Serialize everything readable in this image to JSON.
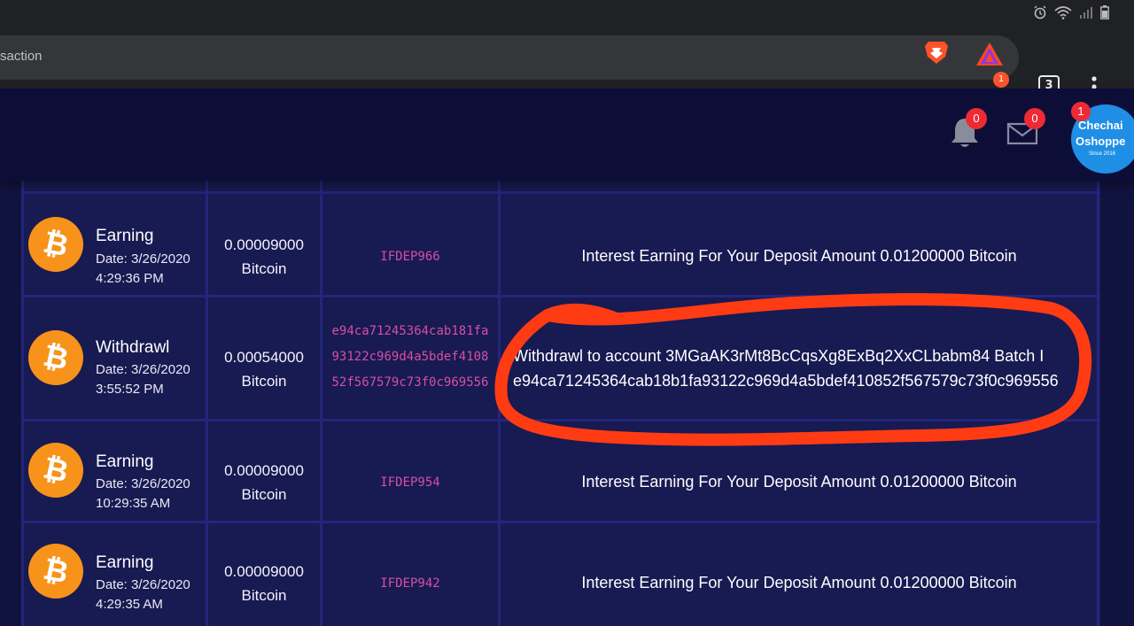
{
  "browser": {
    "url_fragment": "saction",
    "rewards_badge": "1",
    "tab_count": "3"
  },
  "header": {
    "notifications_count": "0",
    "messages_count": "0",
    "avatar_badge": "1",
    "avatar_line1": "Chechai",
    "avatar_line2": "Oshoppe",
    "avatar_line3": "Since 2016"
  },
  "colors": {
    "header_bg": "#0d0e38",
    "table_bg": "#181a52",
    "ref_text": "#d64fa3",
    "bitcoin_orange": "#f7931a",
    "annotation_red": "#ff3b14"
  },
  "transactions": [
    {
      "icon": "bitcoin-icon",
      "type": "Earning",
      "date": "Date: 3/26/2020",
      "time": "4:29:36 PM",
      "amount": "0.00009000",
      "currency": "Bitcoin",
      "reference": "IFDEP966",
      "details": "Interest Earning For Your Deposit Amount 0.01200000 Bitcoin"
    },
    {
      "icon": "bitcoin-icon",
      "type": "Withdrawl",
      "date": "Date: 3/26/2020",
      "time": "3:55:52 PM",
      "amount": "0.00054000",
      "currency": "Bitcoin",
      "reference": "e94ca71245364cab181fa93122c969d4a5bdef410852f567579c73f0c969556",
      "details_line1": "Withdrawl to account 3MGaAK3rMt8BcCqsXg8ExBq2XxCLbabm84 Batch I",
      "details_line2": "e94ca71245364cab18b1fa93122c969d4a5bdef410852f567579c73f0c969556"
    },
    {
      "icon": "bitcoin-icon",
      "type": "Earning",
      "date": "Date: 3/26/2020",
      "time": "10:29:35 AM",
      "amount": "0.00009000",
      "currency": "Bitcoin",
      "reference": "IFDEP954",
      "details": "Interest Earning For Your Deposit Amount 0.01200000 Bitcoin"
    },
    {
      "icon": "bitcoin-icon",
      "type": "Earning",
      "date": "Date: 3/26/2020",
      "time": "4:29:35 AM",
      "amount": "0.00009000",
      "currency": "Bitcoin",
      "reference": "IFDEP942",
      "details": "Interest Earning For Your Deposit Amount 0.01200000 Bitcoin"
    }
  ]
}
